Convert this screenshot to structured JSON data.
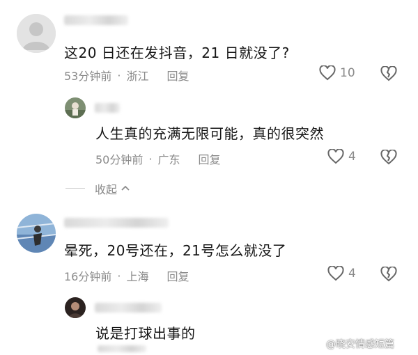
{
  "comments": [
    {
      "text": "这20 日还在发抖音，21 日就没了?",
      "time": "53分钟前",
      "location": "浙江",
      "reply": "回复",
      "likes": "10",
      "replies": [
        {
          "text": "人生真的充满无限可能，真的很突然",
          "time": "50分钟前",
          "location": "广东",
          "reply": "回复",
          "likes": "4"
        }
      ],
      "collapse": "收起"
    },
    {
      "text": "晕死，20号还在，21号怎么就没了",
      "time": "16分钟前",
      "location": "上海",
      "reply": "回复",
      "likes": "4",
      "replies": [
        {
          "text": "说是打球出事的"
        }
      ]
    }
  ],
  "watermark": "@晓安情感短篇",
  "separator": "·",
  "icons": {
    "like": "heart-outline-icon",
    "dislike": "broken-heart-icon",
    "collapse": "chevron-up-icon"
  }
}
